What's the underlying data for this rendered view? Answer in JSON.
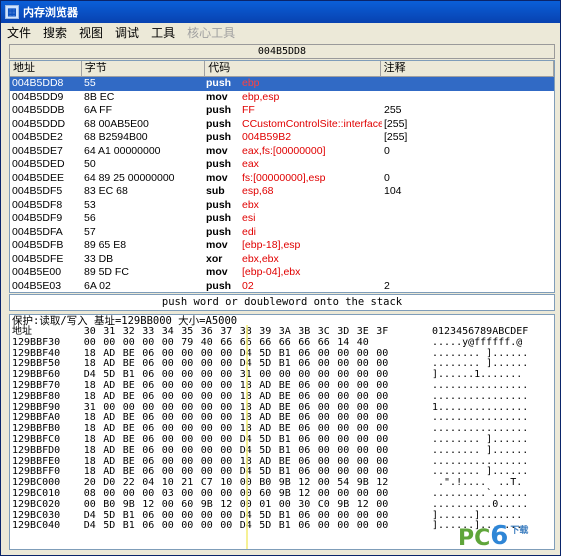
{
  "window": {
    "title": "内存浏览器",
    "icon": "memory-viewer-icon"
  },
  "menus": [
    {
      "label": "文件",
      "enabled": true
    },
    {
      "label": "搜索",
      "enabled": true
    },
    {
      "label": "视图",
      "enabled": true
    },
    {
      "label": "调试",
      "enabled": true
    },
    {
      "label": "工具",
      "enabled": true
    },
    {
      "label": "核心工具",
      "enabled": false
    }
  ],
  "address_bar": "004B5DD8",
  "disasm": {
    "headers": [
      "地址",
      "字节",
      "代码",
      "注释"
    ],
    "rows": [
      {
        "addr": "004B5DD8",
        "bytes": "55",
        "mn": "push",
        "op": "ebp",
        "cm": "",
        "selected": true
      },
      {
        "addr": "004B5DD9",
        "bytes": "8B EC",
        "mn": "mov",
        "op": "ebp,esp",
        "cm": ""
      },
      {
        "addr": "004B5DDB",
        "bytes": "6A FF",
        "mn": "push",
        "op": "FF",
        "cm": "255"
      },
      {
        "addr": "004B5DDD",
        "bytes": "68 00AB5E00",
        "mn": "push",
        "op": "CCustomControlSite::interfaceMap+",
        "cm": "[255]"
      },
      {
        "addr": "004B5DE2",
        "bytes": "68 B2594B00",
        "mn": "push",
        "op": "004B59B2",
        "cm": "[255]"
      },
      {
        "addr": "004B5DE7",
        "bytes": "64 A1 00000000",
        "mn": "mov",
        "op": "eax,fs:[00000000]",
        "cm": "0"
      },
      {
        "addr": "004B5DED",
        "bytes": "50",
        "mn": "push",
        "op": "eax",
        "cm": ""
      },
      {
        "addr": "004B5DEE",
        "bytes": "64 89 25 00000000",
        "mn": "mov",
        "op": "fs:[00000000],esp",
        "cm": "0"
      },
      {
        "addr": "004B5DF5",
        "bytes": "83 EC 68",
        "mn": "sub",
        "op": "esp,68",
        "cm": "104"
      },
      {
        "addr": "004B5DF8",
        "bytes": "53",
        "mn": "push",
        "op": "ebx",
        "cm": ""
      },
      {
        "addr": "004B5DF9",
        "bytes": "56",
        "mn": "push",
        "op": "esi",
        "cm": ""
      },
      {
        "addr": "004B5DFA",
        "bytes": "57",
        "mn": "push",
        "op": "edi",
        "cm": ""
      },
      {
        "addr": "004B5DFB",
        "bytes": "89 65 E8",
        "mn": "mov",
        "op": "[ebp-18],esp",
        "cm": ""
      },
      {
        "addr": "004B5DFE",
        "bytes": "33 DB",
        "mn": "xor",
        "op": "ebx,ebx",
        "cm": ""
      },
      {
        "addr": "004B5E00",
        "bytes": "89 5D FC",
        "mn": "mov",
        "op": "[ebp-04],ebx",
        "cm": ""
      },
      {
        "addr": "004B5E03",
        "bytes": "6A 02",
        "mn": "push",
        "op": "02",
        "cm": "2"
      }
    ]
  },
  "status_text": "push word or doubleword onto the stack",
  "hex": {
    "info": "保护:读取/写入   基址=129BB000 大小=A5000",
    "header_addr": "地址",
    "header_cols": [
      "30",
      "31",
      "32",
      "33",
      "34",
      "35",
      "36",
      "37",
      "38",
      "39",
      "3A",
      "3B",
      "3C",
      "3D",
      "3E",
      "3F"
    ],
    "header_ascii": "0123456789ABCDEF",
    "rows": [
      {
        "a": "129BBF30",
        "b": [
          "00",
          "00",
          "00",
          "00",
          "00",
          "79",
          "40",
          "66",
          "66",
          "66",
          "66",
          "66",
          "66",
          "14",
          "40"
        ],
        "s": ".....y@ffffff.@"
      },
      {
        "a": "129BBF40",
        "b": [
          "18",
          "AD",
          "BE",
          "06",
          "00",
          "00",
          "00",
          "00",
          "D4",
          "5D",
          "B1",
          "06",
          "00",
          "00",
          "00",
          "00"
        ],
        "s": "........ ]......"
      },
      {
        "a": "129BBF50",
        "b": [
          "18",
          "AD",
          "BE",
          "06",
          "00",
          "00",
          "00",
          "00",
          "D4",
          "5D",
          "B1",
          "06",
          "00",
          "00",
          "00",
          "00"
        ],
        "s": "........ ]......"
      },
      {
        "a": "129BBF60",
        "b": [
          "D4",
          "5D",
          "B1",
          "06",
          "00",
          "00",
          "00",
          "00",
          "31",
          "00",
          "00",
          "00",
          "00",
          "00",
          "00",
          "00"
        ],
        "s": "]......1......."
      },
      {
        "a": "129BBF70",
        "b": [
          "18",
          "AD",
          "BE",
          "06",
          "00",
          "00",
          "00",
          "00",
          "18",
          "AD",
          "BE",
          "06",
          "00",
          "00",
          "00",
          "00"
        ],
        "s": "................"
      },
      {
        "a": "129BBF80",
        "b": [
          "18",
          "AD",
          "BE",
          "06",
          "00",
          "00",
          "00",
          "00",
          "18",
          "AD",
          "BE",
          "06",
          "00",
          "00",
          "00",
          "00"
        ],
        "s": "................"
      },
      {
        "a": "129BBF90",
        "b": [
          "31",
          "00",
          "00",
          "00",
          "00",
          "00",
          "00",
          "00",
          "18",
          "AD",
          "BE",
          "06",
          "00",
          "00",
          "00",
          "00"
        ],
        "s": "1..............."
      },
      {
        "a": "129BBFA0",
        "b": [
          "18",
          "AD",
          "BE",
          "06",
          "00",
          "00",
          "00",
          "00",
          "18",
          "AD",
          "BE",
          "06",
          "00",
          "00",
          "00",
          "00"
        ],
        "s": "................"
      },
      {
        "a": "129BBFB0",
        "b": [
          "18",
          "AD",
          "BE",
          "06",
          "00",
          "00",
          "00",
          "00",
          "18",
          "AD",
          "BE",
          "06",
          "00",
          "00",
          "00",
          "00"
        ],
        "s": "................"
      },
      {
        "a": "129BBFC0",
        "b": [
          "18",
          "AD",
          "BE",
          "06",
          "00",
          "00",
          "00",
          "00",
          "D4",
          "5D",
          "B1",
          "06",
          "00",
          "00",
          "00",
          "00"
        ],
        "s": "........ ]......"
      },
      {
        "a": "129BBFD0",
        "b": [
          "18",
          "AD",
          "BE",
          "06",
          "00",
          "00",
          "00",
          "00",
          "D4",
          "5D",
          "B1",
          "06",
          "00",
          "00",
          "00",
          "00"
        ],
        "s": "........ ]......"
      },
      {
        "a": "129BBFE0",
        "b": [
          "18",
          "AD",
          "BE",
          "06",
          "00",
          "00",
          "00",
          "00",
          "18",
          "AD",
          "BE",
          "06",
          "00",
          "00",
          "00",
          "00"
        ],
        "s": "................"
      },
      {
        "a": "129BBFF0",
        "b": [
          "18",
          "AD",
          "BE",
          "06",
          "00",
          "00",
          "00",
          "00",
          "D4",
          "5D",
          "B1",
          "06",
          "00",
          "00",
          "00",
          "00"
        ],
        "s": "........ ]......"
      },
      {
        "a": "129BC000",
        "b": [
          "20",
          "D0",
          "22",
          "04",
          "10",
          "21",
          "C7",
          "10",
          "00",
          "B0",
          "9B",
          "12",
          "00",
          "54",
          "9B",
          "12"
        ],
        "s": " .\".!....  ..T."
      },
      {
        "a": "129BC010",
        "b": [
          "08",
          "00",
          "00",
          "00",
          "03",
          "00",
          "00",
          "00",
          "00",
          "60",
          "9B",
          "12",
          "00",
          "00",
          "00",
          "00"
        ],
        "s": ".........`......"
      },
      {
        "a": "129BC020",
        "b": [
          "00",
          "B0",
          "9B",
          "12",
          "00",
          "60",
          "9B",
          "12",
          "00",
          "01",
          "00",
          "30",
          "C0",
          "9B",
          "12",
          "00"
        ],
        "s": "..........0....."
      },
      {
        "a": "129BC030",
        "b": [
          "D4",
          "5D",
          "B1",
          "06",
          "00",
          "00",
          "00",
          "00",
          "D4",
          "5D",
          "B1",
          "06",
          "00",
          "00",
          "00",
          "00"
        ],
        "s": "]......]......."
      },
      {
        "a": "129BC040",
        "b": [
          "D4",
          "5D",
          "B1",
          "06",
          "00",
          "00",
          "00",
          "00",
          "D4",
          "5D",
          "B1",
          "06",
          "00",
          "00",
          "00",
          "00"
        ],
        "s": "]......]......."
      }
    ]
  },
  "watermark": {
    "pc": "PC",
    "six": "6",
    "sub": "下载"
  }
}
